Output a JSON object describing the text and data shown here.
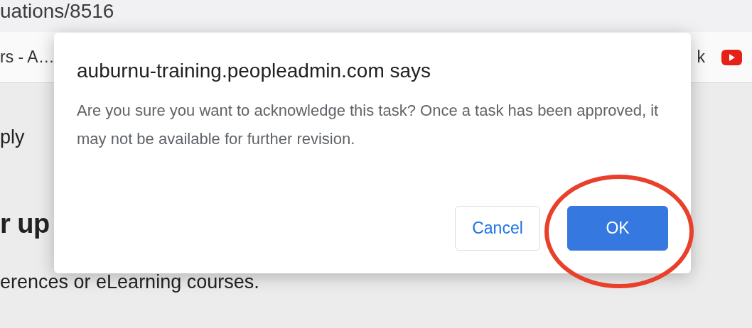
{
  "browser": {
    "address": "uations/8516",
    "bookmarks": [
      {
        "label": "rs - A…"
      },
      {
        "label": "k"
      }
    ]
  },
  "page": {
    "texts": [
      {
        "kind": "paragraph",
        "text": "ply"
      },
      {
        "kind": "heading",
        "text": "r up"
      },
      {
        "kind": "paragraph",
        "text": "erences or eLearning courses."
      }
    ]
  },
  "dialog": {
    "title": "auburnu-training.peopleadmin.com says",
    "message": "Are you sure you want to acknowledge this task? Once a task has been approved, it may not be available for further revision.",
    "buttons": [
      {
        "label": "Cancel",
        "primary": false
      },
      {
        "label": "OK",
        "primary": true
      }
    ]
  },
  "annotations": [
    {
      "kind": "ellipse"
    }
  ]
}
